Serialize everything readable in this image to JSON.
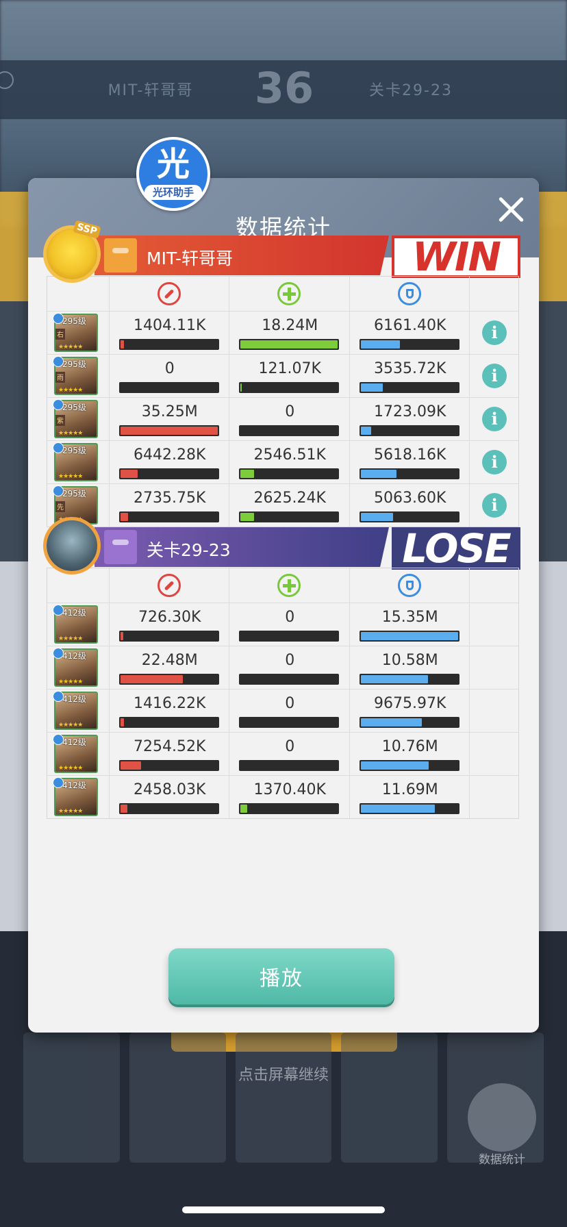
{
  "background": {
    "score": "36",
    "left_player": "MIT-轩哥哥",
    "right_player": "关卡29-23",
    "continue_hint": "点击屏幕继续",
    "stats_button_label": "数据统计"
  },
  "helper_badge": {
    "char": "光",
    "label": "光环助手"
  },
  "dialog": {
    "title": "数据统计"
  },
  "teams": [
    {
      "name": "MIT-轩哥哥",
      "result": "WIN",
      "heroes": [
        {
          "level": "295级",
          "tag": "右",
          "damage": "1404.11K",
          "heal": "18.24M",
          "shield": "6161.40K",
          "damage_frac": 0.04,
          "heal_frac": 1.0,
          "shield_frac": 0.4
        },
        {
          "level": "295级",
          "tag": "雨",
          "damage": "0",
          "heal": "121.07K",
          "shield": "3535.72K",
          "damage_frac": 0.0,
          "heal_frac": 0.01,
          "shield_frac": 0.23
        },
        {
          "level": "295级",
          "tag": "紫",
          "damage": "35.25M",
          "heal": "0",
          "shield": "1723.09K",
          "damage_frac": 1.0,
          "heal_frac": 0.0,
          "shield_frac": 0.11
        },
        {
          "level": "295级",
          "tag": "",
          "damage": "6442.28K",
          "heal": "2546.51K",
          "shield": "5618.16K",
          "damage_frac": 0.18,
          "heal_frac": 0.14,
          "shield_frac": 0.37
        },
        {
          "level": "295级",
          "tag": "先",
          "damage": "2735.75K",
          "heal": "2625.24K",
          "shield": "5063.60K",
          "damage_frac": 0.08,
          "heal_frac": 0.14,
          "shield_frac": 0.33
        }
      ]
    },
    {
      "name": "关卡29-23",
      "result": "LOSE",
      "heroes": [
        {
          "level": "412级",
          "damage": "726.30K",
          "heal": "0",
          "shield": "15.35M",
          "damage_frac": 0.03,
          "heal_frac": 0.0,
          "shield_frac": 1.0
        },
        {
          "level": "412级",
          "damage": "22.48M",
          "heal": "0",
          "shield": "10.58M",
          "damage_frac": 0.64,
          "heal_frac": 0.0,
          "shield_frac": 0.69
        },
        {
          "level": "412级",
          "damage": "1416.22K",
          "heal": "0",
          "shield": "9675.97K",
          "damage_frac": 0.04,
          "heal_frac": 0.0,
          "shield_frac": 0.63
        },
        {
          "level": "412级",
          "damage": "7254.52K",
          "heal": "0",
          "shield": "10.76M",
          "damage_frac": 0.21,
          "heal_frac": 0.0,
          "shield_frac": 0.7
        },
        {
          "level": "412级",
          "damage": "2458.03K",
          "heal": "1370.40K",
          "shield": "11.69M",
          "damage_frac": 0.07,
          "heal_frac": 0.07,
          "shield_frac": 0.76
        }
      ]
    }
  ],
  "play_button": {
    "label": "播放"
  },
  "colors": {
    "damage": "#e05246",
    "heal": "#7ccc3c",
    "shield": "#5aaef0",
    "win": "#d7322c",
    "lose": "#3b3f7c",
    "accent": "#5cc0ba"
  },
  "icons": {
    "damage": "sword-icon",
    "heal": "plus-icon",
    "shield": "shield-icon",
    "info": "info-icon",
    "close": "close-icon"
  }
}
